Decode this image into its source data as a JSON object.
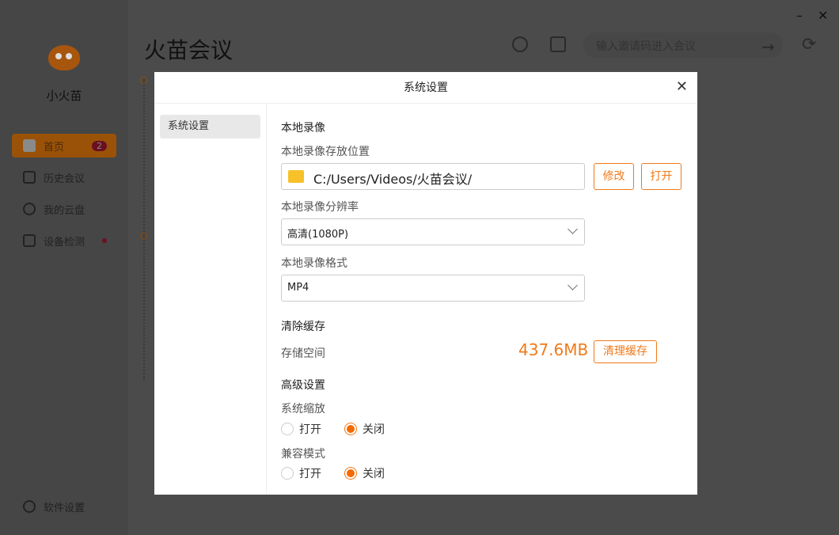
{
  "app": {
    "name": "小火苗",
    "title": "火苗会议"
  },
  "nav": [
    {
      "label": "首页",
      "badge": "2"
    },
    {
      "label": "历史会议"
    },
    {
      "label": "我的云盘"
    },
    {
      "label": "设备检测"
    }
  ],
  "bottom_nav": {
    "label": "软件设置"
  },
  "search": {
    "placeholder": "输入邀请码进入会议"
  },
  "modal": {
    "title": "系统设置",
    "tab": "系统设置",
    "local_recording": {
      "heading": "本地录像",
      "location_label": "本地录像存放位置",
      "path": "C:/Users/Videos/火苗会议/",
      "modify": "修改",
      "open": "打开",
      "resolution_label": "本地录像分辨率",
      "resolution": "高清(1080P)",
      "format_label": "本地录像格式",
      "format": "MP4"
    },
    "cache": {
      "heading": "清除缓存",
      "storage_label": "存储空间",
      "size": "437.6MB",
      "clear": "清理缓存"
    },
    "advanced": {
      "heading": "高级设置",
      "scaling_label": "系统缩放",
      "compat_label": "兼容模式",
      "on": "打开",
      "off": "关闭"
    }
  }
}
